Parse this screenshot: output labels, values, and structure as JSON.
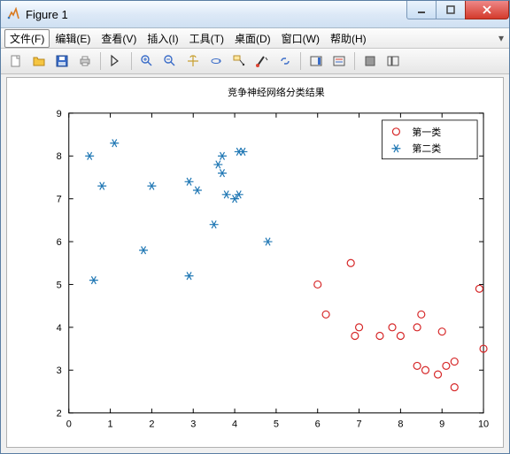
{
  "window": {
    "title": "Figure 1"
  },
  "menu": {
    "file": "文件(F)",
    "edit": "编辑(E)",
    "view": "查看(V)",
    "insert": "插入(I)",
    "tools": "工具(T)",
    "desktop": "桌面(D)",
    "window": "窗口(W)",
    "help": "帮助(H)"
  },
  "legend": {
    "series1": "第一类",
    "series2": "第二类"
  },
  "chart_data": {
    "type": "scatter",
    "title": "竞争神经网络分类结果",
    "xlabel": "",
    "ylabel": "",
    "xlim": [
      0,
      10
    ],
    "ylim": [
      2,
      9
    ],
    "xticks": [
      0,
      1,
      2,
      3,
      4,
      5,
      6,
      7,
      8,
      9,
      10
    ],
    "yticks": [
      2,
      3,
      4,
      5,
      6,
      7,
      8,
      9
    ],
    "legend_position": "upper right",
    "series": [
      {
        "name": "第一类",
        "marker": "o",
        "color": "#d62728",
        "x": [
          6.0,
          6.2,
          6.8,
          6.9,
          7.0,
          7.5,
          7.8,
          8.0,
          8.4,
          8.4,
          8.5,
          8.6,
          8.9,
          9.0,
          9.1,
          9.3,
          9.3,
          9.9,
          10.0
        ],
        "y": [
          5.0,
          4.3,
          5.5,
          3.8,
          4.0,
          3.8,
          4.0,
          3.8,
          4.0,
          3.1,
          4.3,
          3.0,
          2.9,
          3.9,
          3.1,
          2.6,
          3.2,
          4.9,
          3.5
        ]
      },
      {
        "name": "第二类",
        "marker": "*",
        "color": "#1f77b4",
        "x": [
          0.5,
          0.6,
          0.8,
          1.1,
          1.8,
          2.0,
          2.9,
          2.9,
          3.1,
          3.5,
          3.6,
          3.7,
          3.7,
          3.8,
          4.0,
          4.1,
          4.1,
          4.2,
          4.8
        ],
        "y": [
          8.0,
          5.1,
          7.3,
          8.3,
          5.8,
          7.3,
          5.2,
          7.4,
          7.2,
          6.4,
          7.8,
          7.6,
          8.0,
          7.1,
          7.0,
          8.1,
          7.1,
          8.1,
          6.0
        ]
      }
    ]
  }
}
